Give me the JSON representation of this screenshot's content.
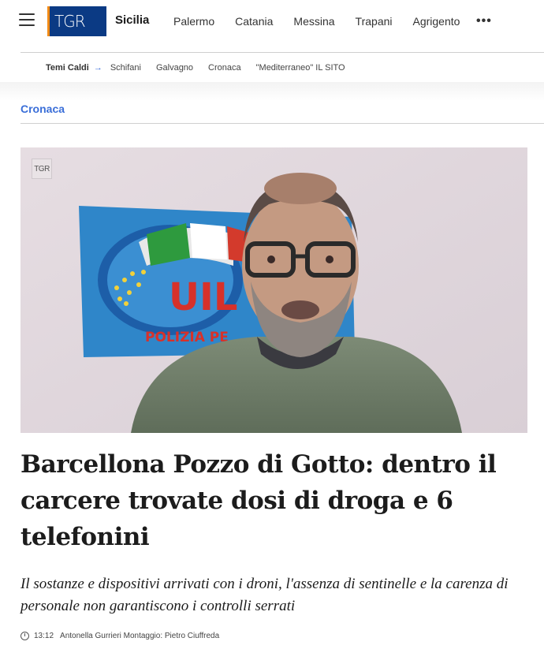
{
  "header": {
    "logo_text": "TGR",
    "region": "Sicilia",
    "nav": [
      "Palermo",
      "Catania",
      "Messina",
      "Trapani",
      "Agrigento"
    ],
    "more": "•••",
    "colors": {
      "logo_bg": "#0b3a84",
      "logo_accent": "#f18a16",
      "link_accent": "#3a6ed8"
    }
  },
  "temi": {
    "label": "Temi Caldi",
    "arrow": "→",
    "links": [
      "Schifani",
      "Galvagno",
      "Cronaca",
      "\"Mediterraneo\" IL SITO"
    ]
  },
  "section": "Cronaca",
  "hero": {
    "watermark": "TGR",
    "flag_text": "UIL",
    "flag_subtext": "POLIZIA PE"
  },
  "article": {
    "title": "Barcellona Pozzo di Gotto: dentro il carcere trovate dosi di droga e 6 telefonini",
    "subtitle": "Il sostanze e dispositivi arrivati con i droni, l'assenza di sentinelle e la carenza di personale non garantiscono i controlli serrati",
    "time": "13:12",
    "byline": "Antonella Gurrieri Montaggio: Pietro Ciuffreda"
  }
}
